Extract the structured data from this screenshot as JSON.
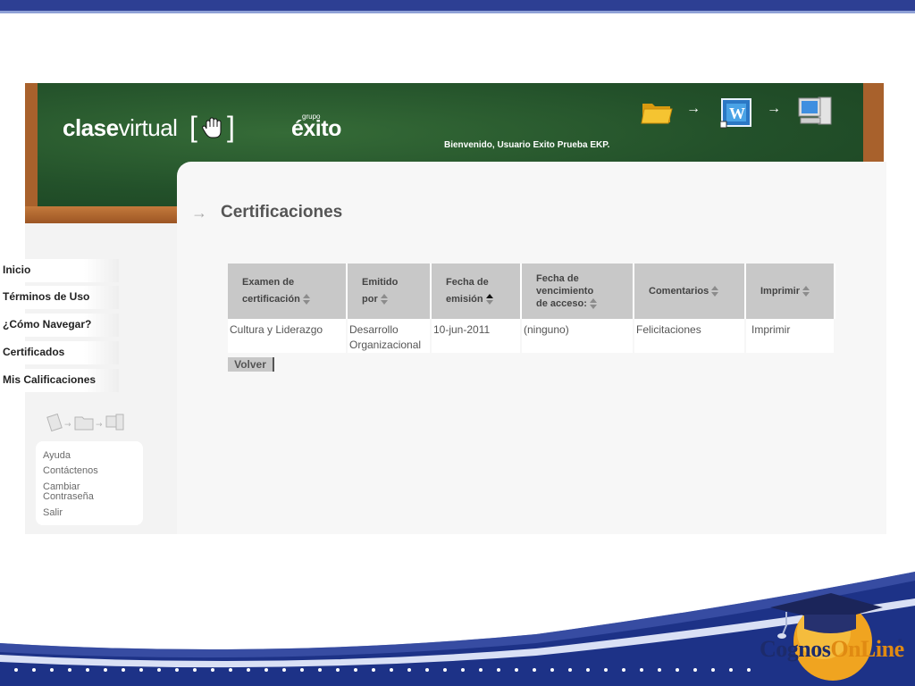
{
  "header": {
    "logo_bold": "clase",
    "logo_thin": "virtual",
    "logo_open": "[",
    "logo_close": "]",
    "brand_small": "grupo",
    "brand": "éxito",
    "welcome": "Bienvenido, Usuario Exito Prueba EKP.",
    "flow_arrow": "→",
    "icons": [
      "folder-icon",
      "word-document-icon",
      "computer-icon"
    ]
  },
  "sidebar": {
    "items": [
      {
        "label": "Inicio"
      },
      {
        "label": "Términos de Uso"
      },
      {
        "label": "¿Cómo Navegar?"
      },
      {
        "label": "Certificados"
      },
      {
        "label": "Mis Calificaciones"
      }
    ],
    "help_links": [
      {
        "label": "Ayuda"
      },
      {
        "label": "Contáctenos"
      },
      {
        "label": "Cambiar"
      },
      {
        "label": "Contraseña"
      },
      {
        "label": "Salir"
      }
    ]
  },
  "main": {
    "title_arrow": "→",
    "title": "Certificaciones",
    "columns": [
      {
        "line1": "Examen de",
        "line2": "certificación"
      },
      {
        "line1": "Emitido",
        "line2": "por"
      },
      {
        "line1": "Fecha de",
        "line2": "emisión"
      },
      {
        "line1": "Fecha de",
        "line2": "vencimiento",
        "line3": "de acceso:"
      },
      {
        "line1": "Comentarios"
      },
      {
        "line1": "Imprimir"
      }
    ],
    "rows": [
      {
        "exam": "Cultura y Liderazgo",
        "issuer_line1": "Desarrollo",
        "issuer_line2": "Organizacional",
        "issue_date": "10-jun-2011",
        "expiry": "(ninguno)",
        "comments": "Felicitaciones",
        "print": "Imprimir"
      }
    ],
    "back_button": "Volver"
  },
  "footer": {
    "brand_a": "Cognos",
    "brand_b": "OnLine",
    "trademark": "®"
  },
  "colors": {
    "top_bar": "#2d3f93",
    "board": "#23512a",
    "board_frame": "#a8612c",
    "table_header": "#c8c8c8",
    "footer_wave": "#1d3287"
  }
}
